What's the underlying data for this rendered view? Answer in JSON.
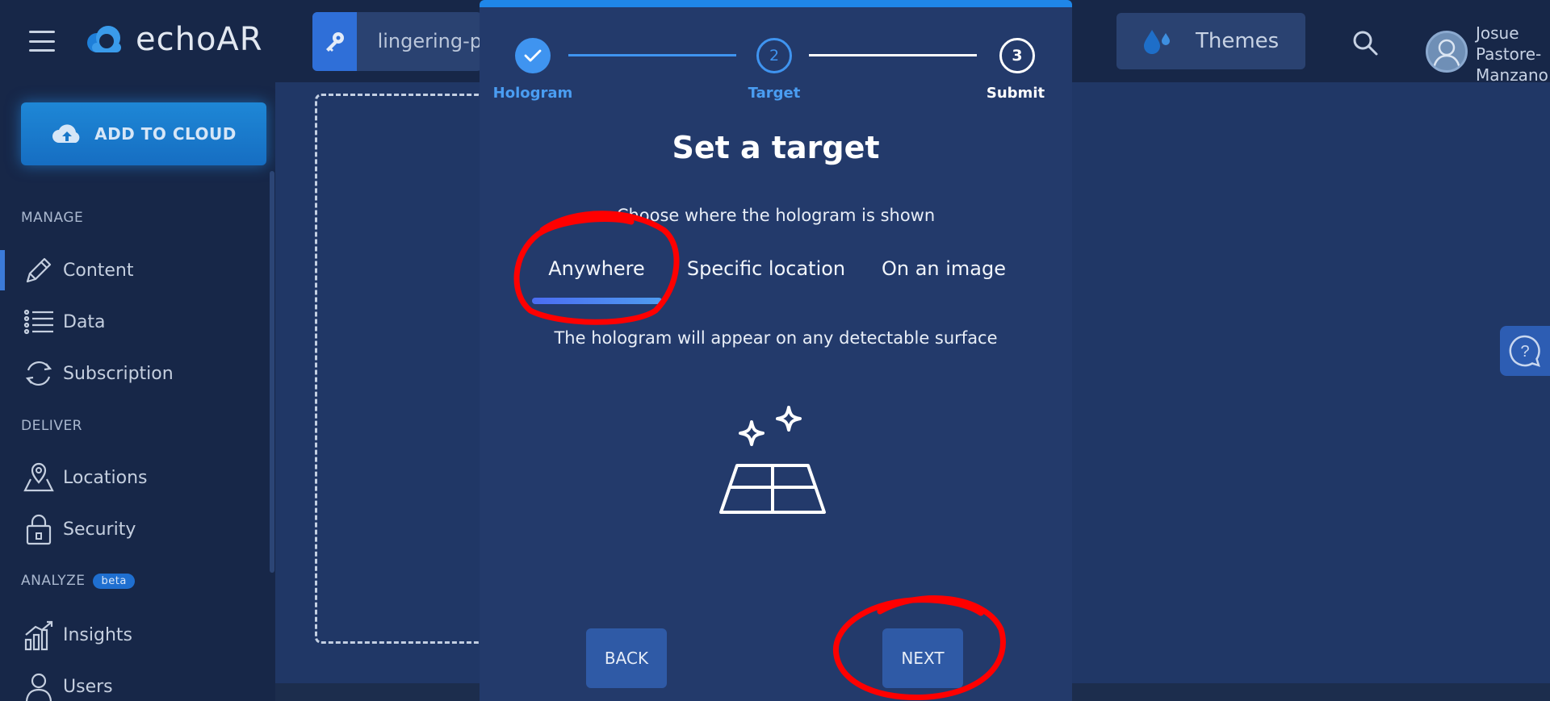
{
  "topbar": {
    "brand": "echoAR",
    "api_key_text": "lingering-p",
    "themes_label": "Themes",
    "user_name": "Josue Pastore-Manzano"
  },
  "sidebar": {
    "add_to_cloud_label": "ADD TO CLOUD",
    "sections": [
      {
        "label": "MANAGE"
      },
      {
        "label": "DELIVER"
      },
      {
        "label": "ANALYZE",
        "badge": "beta"
      }
    ],
    "items": [
      {
        "label": "Content",
        "icon": "pencil-icon",
        "active": true
      },
      {
        "label": "Data",
        "icon": "list-icon"
      },
      {
        "label": "Subscription",
        "icon": "refresh-icon"
      },
      {
        "label": "Locations",
        "icon": "map-pin-icon"
      },
      {
        "label": "Security",
        "icon": "lock-icon"
      },
      {
        "label": "Insights",
        "icon": "chart-icon"
      },
      {
        "label": "Users",
        "icon": "user-icon"
      }
    ]
  },
  "modal": {
    "steps": [
      {
        "label": "Hologram",
        "state": "done"
      },
      {
        "label": "Target",
        "number": "2",
        "state": "current"
      },
      {
        "label": "Submit",
        "number": "3",
        "state": "upcoming"
      }
    ],
    "title": "Set a target",
    "subtitle": "Choose where the hologram is shown",
    "tabs": [
      {
        "label": "Anywhere",
        "selected": true
      },
      {
        "label": "Specific location"
      },
      {
        "label": "On an image"
      }
    ],
    "tab_description": "The hologram will appear on any detectable surface",
    "back_label": "BACK",
    "next_label": "NEXT"
  },
  "colors": {
    "accent": "#1f86e8",
    "annotation": "#ff0000",
    "sidebar_bg": "#172748",
    "modal_bg": "#233a6b"
  }
}
